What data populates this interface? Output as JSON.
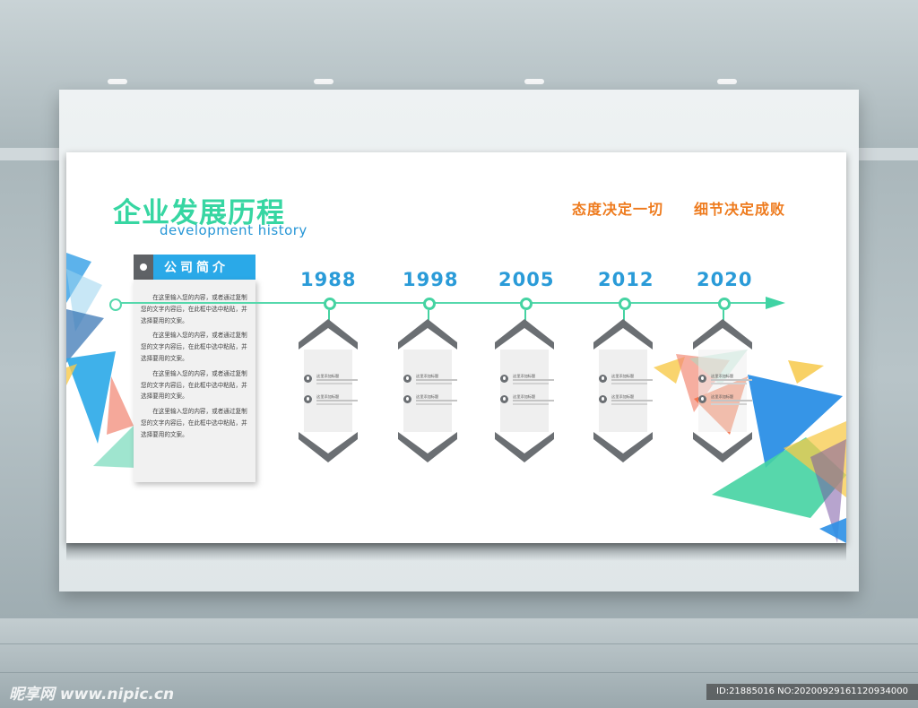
{
  "board": {
    "title": "企业发展历程",
    "subtitle": "development history",
    "slogan_1": "态度决定一切",
    "slogan_2": "细节决定成败"
  },
  "intro": {
    "tab_label": "公司简介",
    "paragraphs": [
      "在这里输入您的内容，或者通过复制您的文字内容后，在此框中选中粘贴，并选择要用的文案。",
      "在这里输入您的内容，或者通过复制您的文字内容后，在此框中选中粘贴，并选择要用的文案。",
      "在这里输入您的内容，或者通过复制您的文字内容后，在此框中选中粘贴，并选择要用的文案。",
      "在这里输入您的内容，或者通过复制您的文字内容后，在此框中选中粘贴，并选择要用的文案。"
    ]
  },
  "timeline": {
    "years": [
      "1988",
      "1998",
      "2005",
      "2012",
      "2020"
    ],
    "entry_heading": "这里添加标题"
  },
  "colors": {
    "title_green": "#37d6a2",
    "accent_blue": "#2a9bd8",
    "slogan_orange": "#ee7b1e",
    "chevron_gray": "#6b6f73"
  },
  "watermark": {
    "site": "昵享网 www.nipic.cn",
    "id_text": "ID:21885016 NO:20200929161120934000"
  }
}
